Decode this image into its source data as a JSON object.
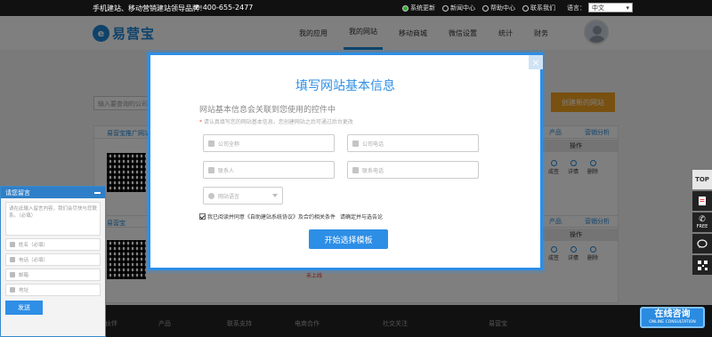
{
  "topbar": {
    "slogan": "手机建站、移动营销建站领导品牌！",
    "phone": "400-655-2477",
    "links": [
      {
        "label": "系统更新",
        "icon": "update-icon"
      },
      {
        "label": "新闻中心",
        "icon": "news-icon"
      },
      {
        "label": "帮助中心",
        "icon": "help-icon"
      },
      {
        "label": "联系我们",
        "icon": "contact-icon"
      }
    ],
    "language_label": "语言：",
    "language_value": "中文"
  },
  "header": {
    "logo_mark": "e",
    "logo_text": "易营宝",
    "nav": [
      "我的应用",
      "我的网站",
      "移动商城",
      "微信设置",
      "统计",
      "财务"
    ],
    "active_nav": "我的网站"
  },
  "background": {
    "search_placeholder": "输入要查询的公司",
    "create_button": "创建新的网站",
    "section1_title": "易营宝推广网站",
    "section2_title": "易营宝",
    "col_product": "产品",
    "col_marketing": "营销分析",
    "col_operation": "操作",
    "ops": [
      "成签",
      "详情",
      "删除"
    ],
    "status_red": "未上线",
    "footer_links": [
      "伙伴",
      "产品",
      "联系支持",
      "电商合作",
      "社交关注",
      "易营宝"
    ]
  },
  "right_toolbar": {
    "top_label": "TOP",
    "items": [
      "doc-icon",
      "phone-free-icon",
      "chat-bubble-icon",
      "qrcode-icon"
    ],
    "free_label": "FREE"
  },
  "chat_panel": {
    "title": "请您留言",
    "message_placeholder": "请在此输入留言内容，我们会尽快与您联系。（必填）",
    "fields": [
      {
        "placeholder": "姓名（必填）",
        "icon": "person-icon"
      },
      {
        "placeholder": "电话（必填）",
        "icon": "phone-icon"
      },
      {
        "placeholder": "邮箱",
        "icon": "mail-icon"
      },
      {
        "placeholder": "地址",
        "icon": "location-icon"
      }
    ],
    "send_label": "发送"
  },
  "consult_badge": {
    "title": "在线咨询",
    "subtitle": "ONLINE CONSULTATION"
  },
  "modal": {
    "close": "×",
    "title": "填写网站基本信息",
    "subtitle": "网站基本信息会关联到您使用的控件中",
    "note_star": "*",
    "note": "请认真填写您的网站基本信息，您创建网站之后可通过后台更改",
    "fields": {
      "company_name": "公司全称",
      "company_phone": "公司电话",
      "contact": "联系人",
      "contact_phone": "联系电话",
      "site_language": "网站语言"
    },
    "agree_text": "我已阅读并同意《自助建站系统协议》及合约相关条件",
    "agree_link": "请确定并与选告论",
    "start_button": "开始选择模板"
  }
}
